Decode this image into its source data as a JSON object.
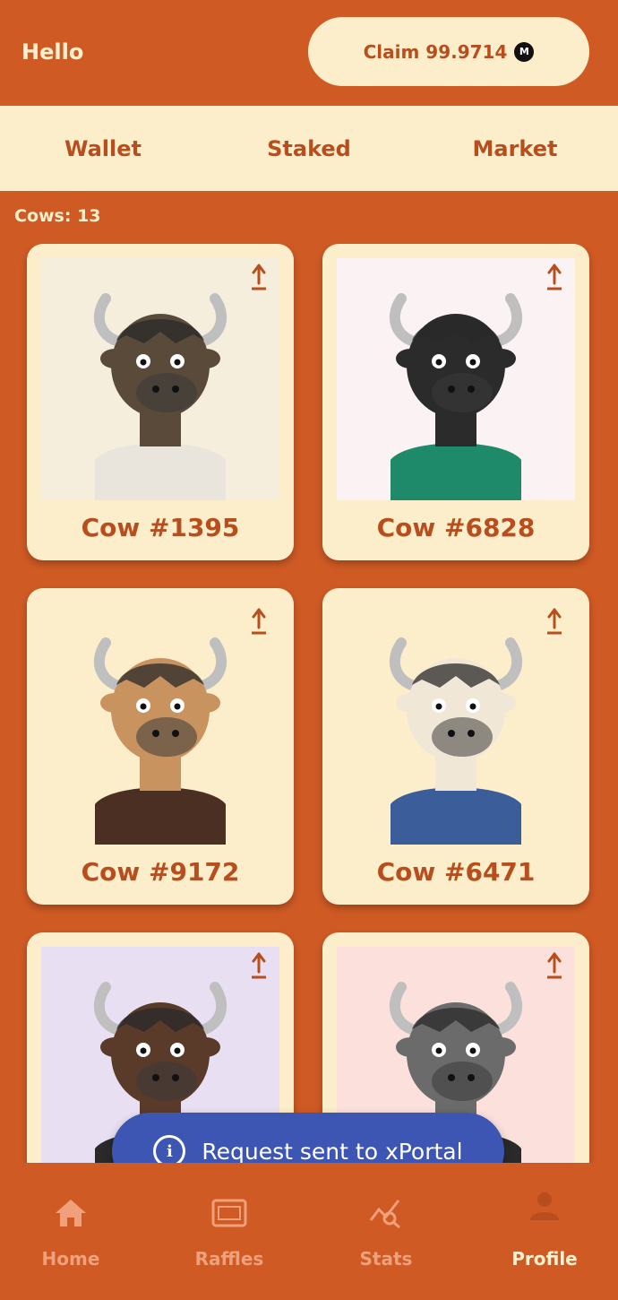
{
  "header": {
    "greeting": "Hello",
    "claim_label": "Claim 99.9714",
    "coin_icon": "M"
  },
  "tabs": [
    {
      "label": "Wallet",
      "active": false
    },
    {
      "label": "Staked",
      "active": true
    },
    {
      "label": "Market",
      "active": false
    }
  ],
  "count_label": "Cows: 13",
  "cards": [
    {
      "title": "Cow #1395",
      "bg": "#f6eedd",
      "fur": "#5a4a3a",
      "clothes": "#e9e4dc"
    },
    {
      "title": "Cow #6828",
      "bg": "#fbf3f3",
      "fur": "#2b2b2b",
      "clothes": "#1f8a6a"
    },
    {
      "title": "Cow #9172",
      "bg": "#fdeecb",
      "fur": "#c8935f",
      "clothes": "#4a2f22"
    },
    {
      "title": "Cow #6471",
      "bg": "#fdeecb",
      "fur": "#f1e7d6",
      "clothes": "#3b5d9a"
    },
    {
      "title": "",
      "bg": "#e8e0f2",
      "fur": "#5a3b2a",
      "clothes": "#2a2a2a"
    },
    {
      "title": "",
      "bg": "#fbe0dc",
      "fur": "#6b6b6b",
      "clothes": "#2a2a2a"
    }
  ],
  "toast": {
    "text": "Request sent to xPortal"
  },
  "nav": [
    {
      "label": "Home",
      "icon": "home-icon"
    },
    {
      "label": "Raffles",
      "icon": "raffle-ticket-icon"
    },
    {
      "label": "Stats",
      "icon": "stats-icon"
    },
    {
      "label": "Profile",
      "icon": "profile-icon",
      "active": true
    }
  ],
  "colors": {
    "bg": "#cf5a24",
    "cream": "#fdeecb",
    "accent": "#b84e1d",
    "toast": "#3e56b3"
  }
}
